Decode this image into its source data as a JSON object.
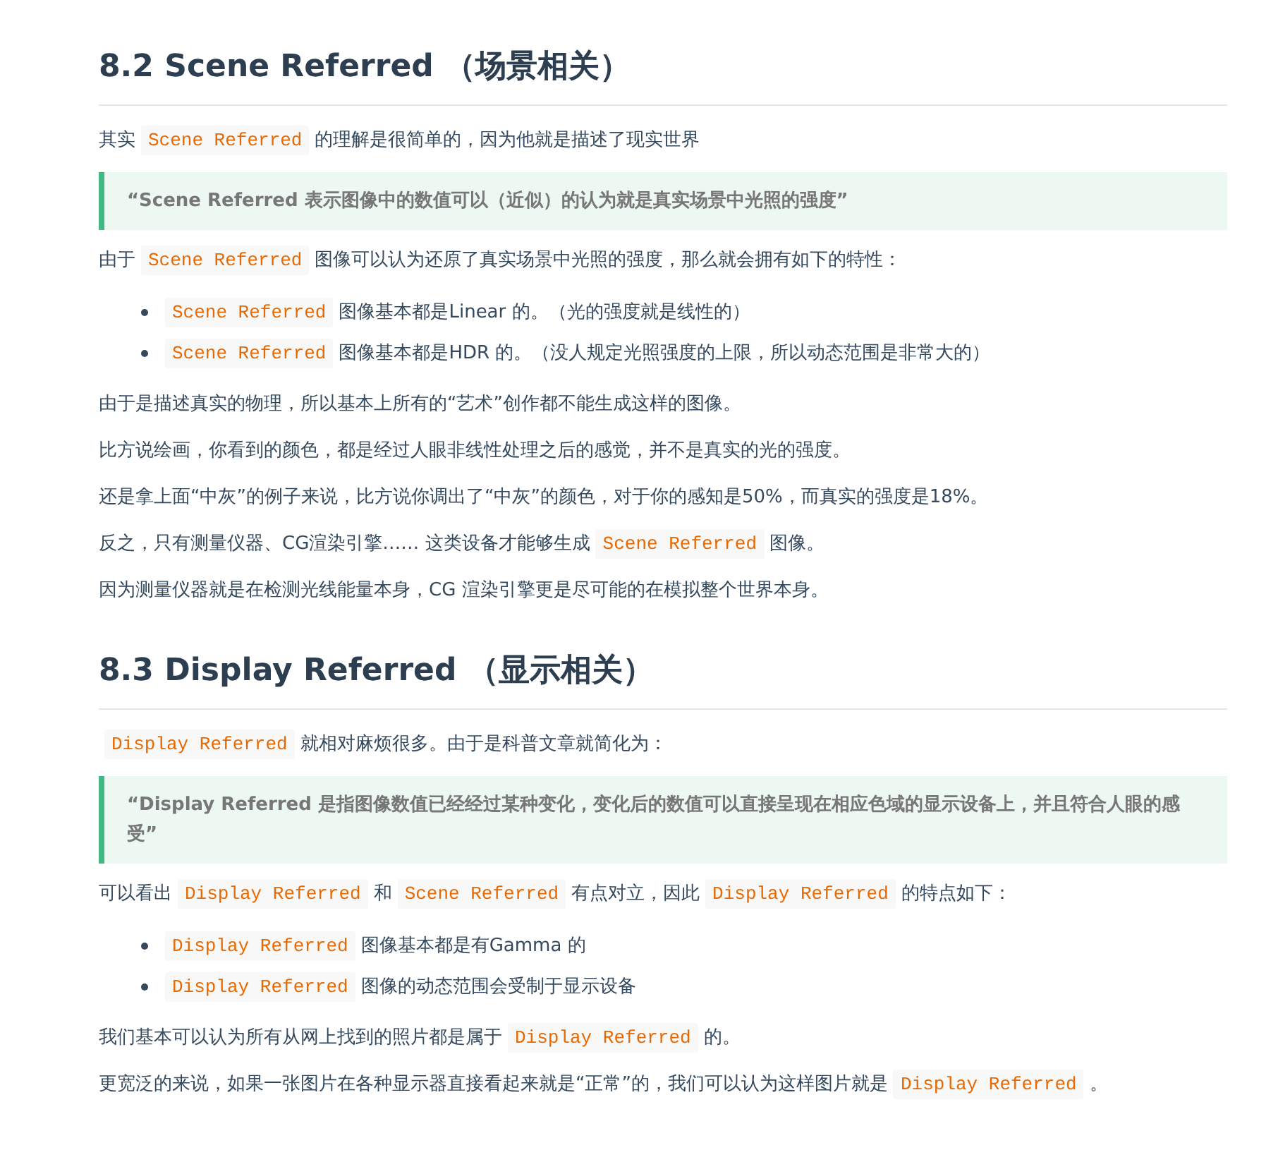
{
  "sections": [
    {
      "heading": "8.2 Scene Referred （场景相关）",
      "blocks": [
        {
          "kind": "paragraph",
          "segments": [
            {
              "kind": "text",
              "text": "其实"
            },
            {
              "kind": "code",
              "text": "Scene Referred"
            },
            {
              "kind": "text",
              "text": "的理解是很简单的，因为他就是描述了现实世界"
            }
          ]
        },
        {
          "kind": "quote",
          "text": "“Scene Referred 表示图像中的数值可以（近似）的认为就是真实场景中光照的强度”"
        },
        {
          "kind": "paragraph",
          "segments": [
            {
              "kind": "text",
              "text": "由于"
            },
            {
              "kind": "code",
              "text": "Scene Referred"
            },
            {
              "kind": "text",
              "text": "图像可以认为还原了真实场景中光照的强度，那么就会拥有如下的特性："
            }
          ]
        },
        {
          "kind": "list",
          "items": [
            {
              "segments": [
                {
                  "kind": "code",
                  "text": "Scene Referred"
                },
                {
                  "kind": "text",
                  "text": "图像基本都是Linear 的。（光的强度就是线性的）"
                }
              ]
            },
            {
              "segments": [
                {
                  "kind": "code",
                  "text": "Scene Referred"
                },
                {
                  "kind": "text",
                  "text": "图像基本都是HDR 的。（没人规定光照强度的上限，所以动态范围是非常大的）"
                }
              ]
            }
          ]
        },
        {
          "kind": "paragraph",
          "segments": [
            {
              "kind": "text",
              "text": "由于是描述真实的物理，所以基本上所有的“艺术”创作都不能生成这样的图像。"
            }
          ]
        },
        {
          "kind": "paragraph",
          "segments": [
            {
              "kind": "text",
              "text": "比方说绘画，你看到的颜色，都是经过人眼非线性处理之后的感觉，并不是真实的光的强度。"
            }
          ]
        },
        {
          "kind": "paragraph",
          "segments": [
            {
              "kind": "text",
              "text": "还是拿上面“中灰”的例子来说，比方说你调出了“中灰”的颜色，对于你的感知是50%，而真实的强度是18%。"
            }
          ]
        },
        {
          "kind": "paragraph",
          "segments": [
            {
              "kind": "text",
              "text": "反之，只有测量仪器、CG渲染引擎…… 这类设备才能够生成"
            },
            {
              "kind": "code",
              "text": "Scene Referred"
            },
            {
              "kind": "text",
              "text": "图像。"
            }
          ]
        },
        {
          "kind": "paragraph",
          "segments": [
            {
              "kind": "text",
              "text": "因为测量仪器就是在检测光线能量本身，CG 渲染引擎更是尽可能的在模拟整个世界本身。"
            }
          ]
        }
      ]
    },
    {
      "heading": "8.3 Display Referred （显示相关）",
      "blocks": [
        {
          "kind": "paragraph",
          "segments": [
            {
              "kind": "code",
              "text": "Display Referred"
            },
            {
              "kind": "text",
              "text": "就相对麻烦很多。由于是科普文章就简化为："
            }
          ]
        },
        {
          "kind": "quote",
          "text": "“Display Referred 是指图像数值已经经过某种变化，变化后的数值可以直接呈现在相应色域的显示设备上，并且符合人眼的感受”"
        },
        {
          "kind": "paragraph",
          "segments": [
            {
              "kind": "text",
              "text": "可以看出"
            },
            {
              "kind": "code",
              "text": "Display Referred"
            },
            {
              "kind": "text",
              "text": "和"
            },
            {
              "kind": "code",
              "text": "Scene Referred"
            },
            {
              "kind": "text",
              "text": "有点对立，因此"
            },
            {
              "kind": "code",
              "text": "Display Referred"
            },
            {
              "kind": "text",
              "text": "的特点如下："
            }
          ]
        },
        {
          "kind": "list",
          "items": [
            {
              "segments": [
                {
                  "kind": "code",
                  "text": "Display Referred"
                },
                {
                  "kind": "text",
                  "text": "图像基本都是有Gamma 的"
                }
              ]
            },
            {
              "segments": [
                {
                  "kind": "code",
                  "text": "Display Referred"
                },
                {
                  "kind": "text",
                  "text": "图像的动态范围会受制于显示设备"
                }
              ]
            }
          ]
        },
        {
          "kind": "paragraph",
          "segments": [
            {
              "kind": "text",
              "text": "我们基本可以认为所有从网上找到的照片都是属于"
            },
            {
              "kind": "code",
              "text": "Display Referred"
            },
            {
              "kind": "text",
              "text": "的。"
            }
          ]
        },
        {
          "kind": "paragraph",
          "segments": [
            {
              "kind": "text",
              "text": "更宽泛的来说，如果一张图片在各种显示器直接看起来就是“正常”的，我们可以认为这样图片就是"
            },
            {
              "kind": "code",
              "text": "Display Referred"
            },
            {
              "kind": "text",
              "text": "。"
            }
          ]
        }
      ]
    }
  ]
}
